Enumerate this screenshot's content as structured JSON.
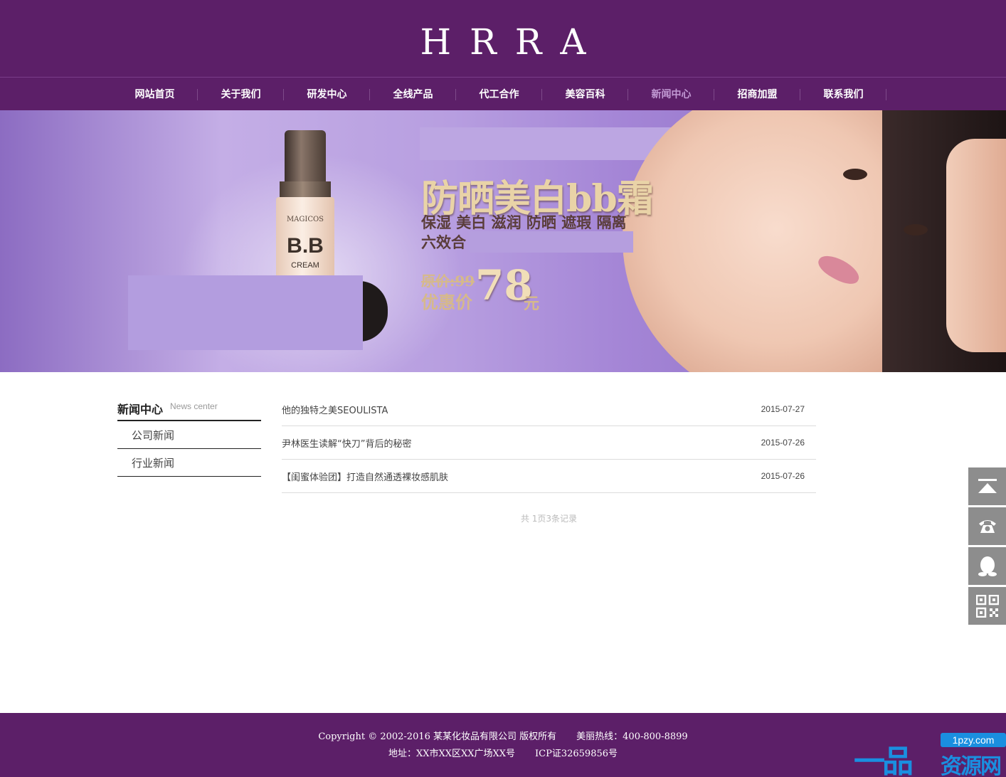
{
  "header": {
    "logo": "HRRA",
    "nav": [
      {
        "label": "网站首页"
      },
      {
        "label": "关于我们"
      },
      {
        "label": "研发中心"
      },
      {
        "label": "全线产品"
      },
      {
        "label": "代工合作"
      },
      {
        "label": "美容百科"
      },
      {
        "label": "新闻中心",
        "active": true
      },
      {
        "label": "招商加盟"
      },
      {
        "label": "联系我们"
      }
    ],
    "colors": {
      "brand": "#5c1f68",
      "active_nav": "#c29ad4"
    }
  },
  "banner": {
    "bottle_brand": "MAGICOS",
    "bottle_label": "B.B",
    "bottle_sub": "CREAM",
    "title": "防晒美白bb霜",
    "subtitle": "保湿 美白 滋润 防晒 遮瑕 隔离",
    "subtitle2": "六效合",
    "original_price": "原价:99",
    "sale_label": "优惠价",
    "sale_price": "78",
    "unit": "元"
  },
  "sidebar": {
    "title": "新闻中心",
    "subtitle": "News center",
    "items": [
      {
        "label": "公司新闻"
      },
      {
        "label": "行业新闻"
      }
    ]
  },
  "news": {
    "items": [
      {
        "title": "他的独特之美SEOULISTA",
        "date": "2015-07-27"
      },
      {
        "title": "尹林医生读解“快刀”背后的秘密",
        "date": "2015-07-26"
      },
      {
        "title": "【闺蜜体验团】打造自然通透裸妆感肌肤",
        "date": "2015-07-26"
      }
    ],
    "pager": "共 1页3条记录"
  },
  "tools": [
    {
      "icon": "back-to-top-icon"
    },
    {
      "icon": "phone-icon"
    },
    {
      "icon": "qq-icon"
    },
    {
      "icon": "qr-code-icon"
    }
  ],
  "footer": {
    "copyright": "Copyright © 2002-2016 某某化妆品有限公司 版权所有",
    "hotline": "美丽热线：400-800-8899",
    "address": "地址：XX市XX区XX广场XX号",
    "icp": "ICP证32659856号"
  },
  "watermark": {
    "url": "1pzy.com",
    "site": "资源网",
    "mark": "一品"
  }
}
